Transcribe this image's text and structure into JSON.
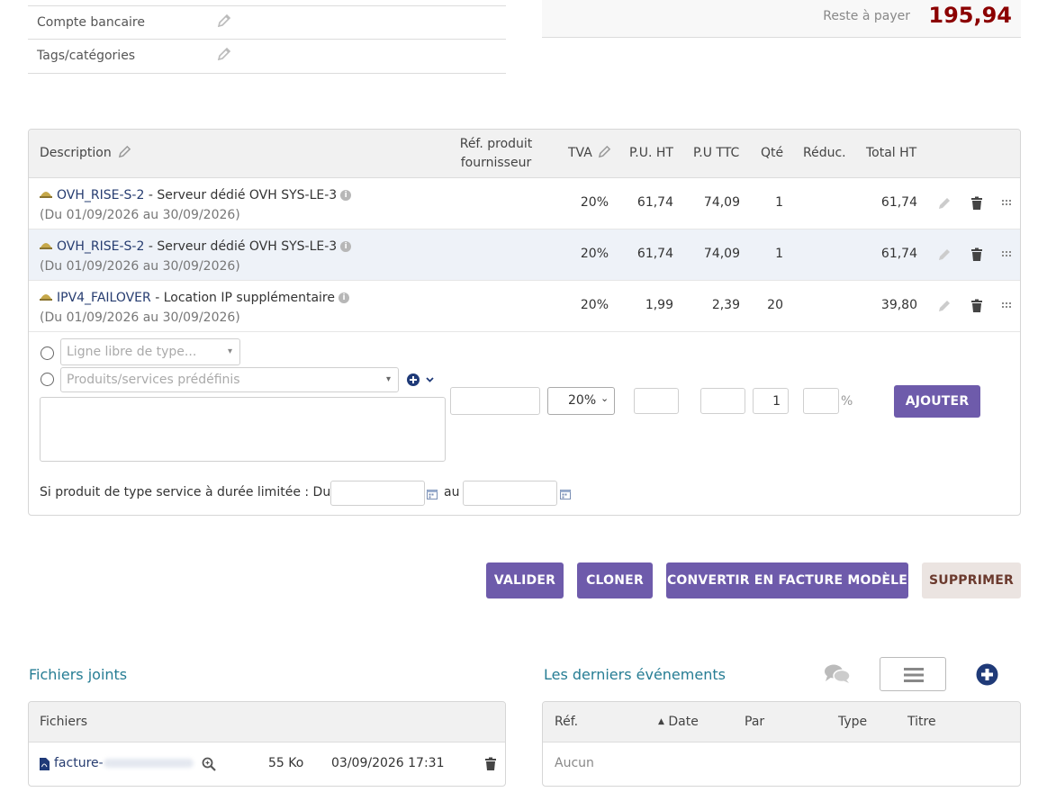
{
  "fields": {
    "bank_account_label": "Compte bancaire",
    "tags_label": "Tags/catégories"
  },
  "payment": {
    "remaining_label": "Reste à payer",
    "remaining_amount": "195,94"
  },
  "lines_table": {
    "headers": {
      "description": "Description",
      "supplier_ref_1": "Réf. produit",
      "supplier_ref_2": "fournisseur",
      "vat": "TVA",
      "unit_price_ht": "P.U. HT",
      "unit_price_ttc": "P.U TTC",
      "qty": "Qté",
      "discount": "Réduc.",
      "total_ht": "Total HT"
    },
    "rows": [
      {
        "ref": "OVH_RISE-S-2",
        "label": " - Serveur dédié OVH SYS-LE-3",
        "dates": "(Du 01/09/2026 au 30/09/2026)",
        "vat": "20%",
        "pu_ht": "61,74",
        "pu_ttc": "74,09",
        "qty": "1",
        "total_ht": "61,74"
      },
      {
        "ref": "OVH_RISE-S-2",
        "label": " - Serveur dédié OVH SYS-LE-3",
        "dates": "(Du 01/09/2026 au 30/09/2026)",
        "vat": "20%",
        "pu_ht": "61,74",
        "pu_ttc": "74,09",
        "qty": "1",
        "total_ht": "61,74"
      },
      {
        "ref": "IPV4_FAILOVER",
        "label": " - Location IP supplémentaire",
        "dates": "(Du 01/09/2026 au 30/09/2026)",
        "vat": "20%",
        "pu_ht": "1,99",
        "pu_ttc": "2,39",
        "qty": "20",
        "total_ht": "39,80"
      }
    ]
  },
  "add_line_form": {
    "free_line_placeholder": "Ligne libre de type...",
    "predefined_placeholder": "Produits/services prédéfinis",
    "vat_selected": "20%",
    "qty_value": "1",
    "percent_sign": "%",
    "add_button": "AJOUTER",
    "service_period_label": "Si produit de type service à durée limitée : Du",
    "to_label": "au"
  },
  "actions": {
    "validate": "VALIDER",
    "clone": "CLONER",
    "convert_template": "CONVERTIR EN FACTURE MODÈLE",
    "delete": "SUPPRIMER"
  },
  "attachments": {
    "title": "Fichiers joints",
    "header": "Fichiers",
    "file": {
      "name": "facture-",
      "size": "55 Ko",
      "date": "03/09/2026 17:31"
    }
  },
  "events": {
    "title": "Les derniers événements",
    "headers": {
      "ref": "Réf.",
      "date": "Date",
      "by": "Par",
      "type": "Type",
      "title": "Titre"
    },
    "empty": "Aucun"
  },
  "colors": {
    "accent": "#6e5bab",
    "amount_due": "#8b0000",
    "section_title": "#267d94",
    "link": "#263c70"
  }
}
